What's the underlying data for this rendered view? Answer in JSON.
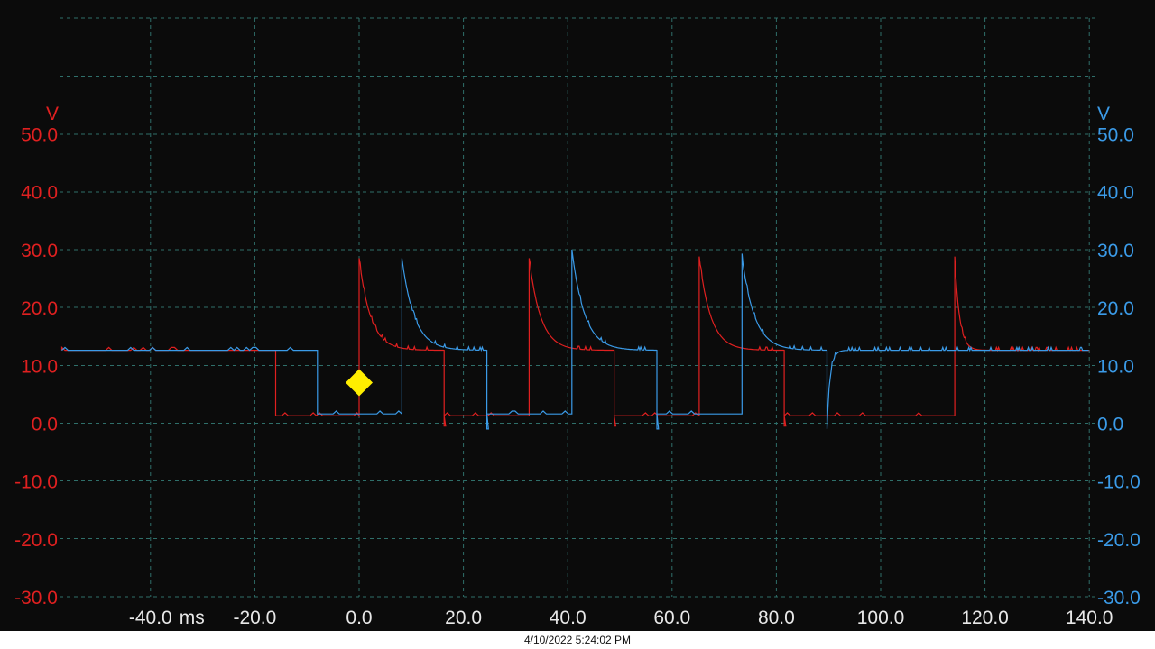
{
  "chart_data": {
    "type": "line",
    "x_unit": "ms",
    "x_ticks": [
      -40.0,
      -20.0,
      0.0,
      20.0,
      40.0,
      60.0,
      80.0,
      100.0,
      120.0,
      140.0
    ],
    "x_tick_labels": [
      "-40.0",
      "-20.0",
      "0.0",
      "20.0",
      "40.0",
      "60.0",
      "80.0",
      "100.0",
      "120.0",
      "140.0"
    ],
    "y_unit_left": "V",
    "y_unit_right": "V",
    "y_ticks": [
      50,
      40,
      30,
      20,
      10,
      0,
      -10,
      -20,
      -30
    ],
    "y_tick_labels": [
      "50.0",
      "40.0",
      "30.0",
      "20.0",
      "10.0",
      "0.0",
      "-10.0",
      "-20.0",
      "-30.0"
    ],
    "ylim": [
      -30,
      50
    ],
    "xlim": [
      -57,
      140
    ],
    "grid": true,
    "trigger": {
      "x": 0.0,
      "y": 7.0
    },
    "series": [
      {
        "color": "#e02020",
        "segments": [
          {
            "type": "step",
            "x0": -57,
            "x1": -16.0,
            "level": 12.6
          },
          {
            "type": "step",
            "x0": -16.0,
            "x1": 0.0,
            "level": 1.3
          },
          {
            "type": "decay",
            "x0": 0.0,
            "x1": 16.3,
            "peak": 28.5,
            "settle": 12.6,
            "tau": 2.2
          },
          {
            "type": "dip",
            "x": 16.3,
            "depth": -0.5
          },
          {
            "type": "step",
            "x0": 16.3,
            "x1": 32.6,
            "level": 1.3
          },
          {
            "type": "decay",
            "x0": 32.6,
            "x1": 48.9,
            "peak": 28.5,
            "settle": 12.6,
            "tau": 2.2
          },
          {
            "type": "dip",
            "x": 48.9,
            "depth": -0.5
          },
          {
            "type": "step",
            "x0": 48.9,
            "x1": 65.2,
            "level": 1.3
          },
          {
            "type": "decay",
            "x0": 65.2,
            "x1": 81.5,
            "peak": 28.8,
            "settle": 12.6,
            "tau": 2.2
          },
          {
            "type": "dip",
            "x": 81.5,
            "depth": -0.5
          },
          {
            "type": "step",
            "x0": 81.5,
            "x1": 114.2,
            "level": 1.3
          },
          {
            "type": "decay",
            "x0": 114.2,
            "x1": 140,
            "peak": 28.8,
            "settle": 12.6,
            "tau": 0.9
          }
        ]
      },
      {
        "color": "#3b9be8",
        "segments": [
          {
            "type": "step",
            "x0": -57,
            "x1": -8.0,
            "level": 12.6
          },
          {
            "type": "step",
            "x0": -8.0,
            "x1": 8.2,
            "level": 1.6
          },
          {
            "type": "decay",
            "x0": 8.2,
            "x1": 24.5,
            "peak": 28.5,
            "settle": 12.6,
            "tau": 2.4
          },
          {
            "type": "dip",
            "x": 24.5,
            "depth": -1.0
          },
          {
            "type": "step",
            "x0": 24.5,
            "x1": 40.8,
            "level": 1.6
          },
          {
            "type": "decay",
            "x0": 40.8,
            "x1": 57.1,
            "peak": 30.0,
            "settle": 12.6,
            "tau": 2.4
          },
          {
            "type": "dip",
            "x": 57.1,
            "depth": -1.0
          },
          {
            "type": "step",
            "x0": 57.1,
            "x1": 73.4,
            "level": 1.6
          },
          {
            "type": "decay",
            "x0": 73.4,
            "x1": 89.7,
            "peak": 28.8,
            "settle": 12.6,
            "tau": 2.4
          },
          {
            "type": "recover",
            "x0": 89.7,
            "x1": 140,
            "start": -1.0,
            "settle": 12.6,
            "tau": 0.6
          }
        ]
      }
    ]
  },
  "timestamp": "4/10/2022 5:24:02 PM",
  "colors": {
    "left_axis": "#e02020",
    "right_axis": "#3b9be8",
    "grid": "#2f6f6a",
    "trigger": "#ffee00"
  }
}
